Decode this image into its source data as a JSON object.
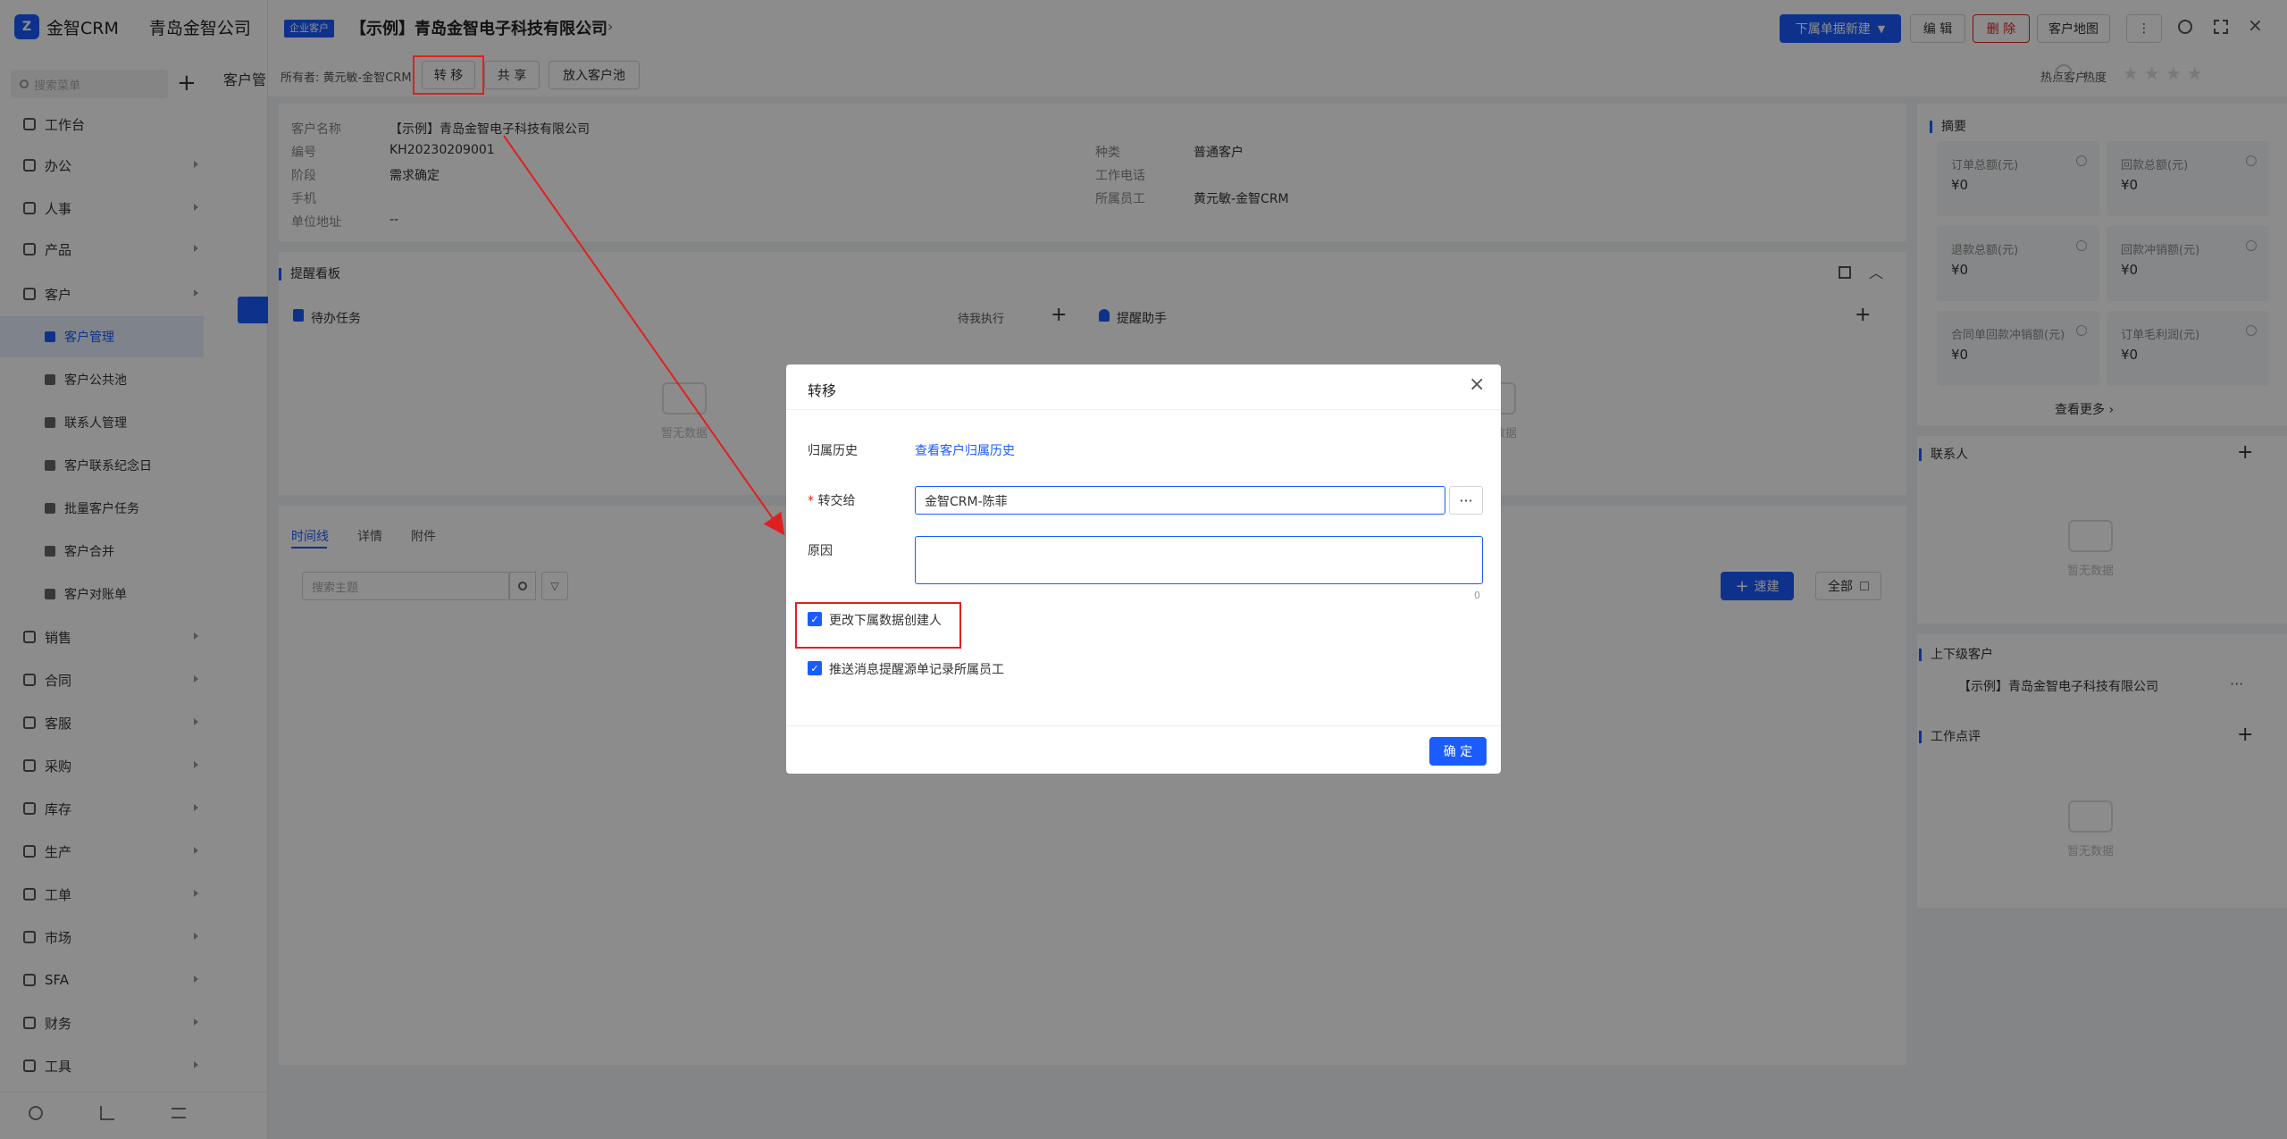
{
  "sidebar": {
    "brand": "金智CRM",
    "company": "青岛金智公司",
    "search_placeholder": "搜索菜单",
    "items": [
      {
        "label": "工作台"
      },
      {
        "label": "办公"
      },
      {
        "label": "人事"
      },
      {
        "label": "产品"
      },
      {
        "label": "客户"
      }
    ],
    "sub_items": [
      {
        "label": "客户管理"
      },
      {
        "label": "客户公共池"
      },
      {
        "label": "联系人管理"
      },
      {
        "label": "客户联系纪念日"
      },
      {
        "label": "批量客户任务"
      },
      {
        "label": "客户合并"
      },
      {
        "label": "客户对账单"
      }
    ],
    "items2": [
      {
        "label": "销售"
      },
      {
        "label": "合同"
      },
      {
        "label": "客服"
      },
      {
        "label": "采购"
      },
      {
        "label": "库存"
      },
      {
        "label": "生产"
      },
      {
        "label": "工单"
      },
      {
        "label": "市场"
      },
      {
        "label": "SFA"
      },
      {
        "label": "财务"
      },
      {
        "label": "工具"
      }
    ]
  },
  "bg_page": {
    "tab_label": "客户管"
  },
  "header": {
    "badge": "企业客户",
    "title": "【示例】青岛金智电子科技有限公司",
    "btn_sub_create": "下属单据新建",
    "btn_edit": "编 辑",
    "btn_delete": "删 除",
    "btn_map": "客户地图",
    "owner_label": "所有者: 黄元敏-金智CRM",
    "btn_transfer": "转 移",
    "btn_share": "共 享",
    "btn_pool": "放入客户池",
    "hot_label": "热点客户",
    "heat_label": "热度"
  },
  "info": {
    "name_label": "客户名称",
    "name_value": "【示例】青岛金智电子科技有限公司",
    "code_label": "编号",
    "code_value": "KH20230209001",
    "stage_label": "阶段",
    "stage_value": "需求确定",
    "mobile_label": "手机",
    "mobile_value": "",
    "address_label": "单位地址",
    "address_value": "--",
    "type_label": "种类",
    "type_value": "普通客户",
    "phone_label": "工作电话",
    "phone_value": "",
    "owner_label": "所属员工",
    "owner_value": "黄元敏-金智CRM"
  },
  "reminder": {
    "title": "提醒看板",
    "todo_title": "待办任务",
    "todo_filter": "待我执行",
    "assistant_title": "提醒助手",
    "empty_text": "暂无数据"
  },
  "timeline": {
    "tabs": [
      "时间线",
      "详情",
      "附件"
    ],
    "search_placeholder": "搜索主题",
    "btn_quick_create": "速建",
    "btn_all": "全部"
  },
  "summary": {
    "title": "摘要",
    "items": [
      {
        "label": "订单总额(元)",
        "value": "¥0"
      },
      {
        "label": "回款总额(元)",
        "value": "¥0"
      },
      {
        "label": "退款总额(元)",
        "value": "¥0"
      },
      {
        "label": "回款冲销额(元)",
        "value": "¥0"
      },
      {
        "label": "合同单回款冲销额(元)",
        "value": "¥0"
      },
      {
        "label": "订单毛利润(元)",
        "value": "¥0"
      }
    ],
    "more": "查看更多"
  },
  "contacts": {
    "title": "联系人",
    "empty_text": "暂无数据"
  },
  "parent": {
    "title": "上下级客户",
    "item": "【示例】青岛金智电子科技有限公司"
  },
  "comments": {
    "title": "工作点评",
    "empty_text": "暂无数据"
  },
  "modal": {
    "title": "转移",
    "history_label": "归属历史",
    "history_link": "查看客户归属历史",
    "transfer_to_label": "转交给",
    "transfer_to_value": "金智CRM-陈菲",
    "reason_label": "原因",
    "reason_count": "0",
    "option1": "更改下属数据创建人",
    "option2": "推送消息提醒源单记录所属员工",
    "confirm": "确 定"
  }
}
